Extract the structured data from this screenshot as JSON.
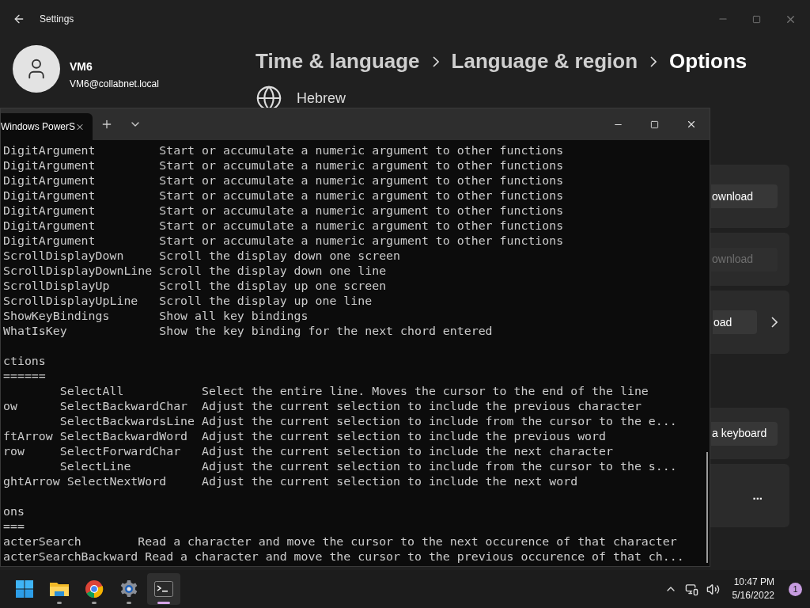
{
  "settings": {
    "title": "Settings",
    "user": {
      "name": "VM6",
      "email": "VM6@collabnet.local"
    },
    "breadcrumb": [
      {
        "label": "Time & language",
        "current": false
      },
      {
        "label": "Language & region",
        "current": false
      },
      {
        "label": "Options",
        "current": true
      }
    ],
    "language": "Hebrew",
    "cards": [
      {
        "kind": "button",
        "label": "ownload",
        "disabled": false,
        "chevron": false
      },
      {
        "kind": "button",
        "label": "ownload",
        "disabled": true,
        "chevron": false
      },
      {
        "kind": "button",
        "label": "oad",
        "disabled": false,
        "chevron": true
      },
      {
        "kind": "gap"
      },
      {
        "kind": "button",
        "label": "a keyboard",
        "disabled": false,
        "chevron": false
      },
      {
        "kind": "more",
        "label": "..."
      }
    ]
  },
  "terminal": {
    "tab_title": "Windows PowerS",
    "blocks": [
      [
        "DigitArgument         Start or accumulate a numeric argument to other functions",
        "DigitArgument         Start or accumulate a numeric argument to other functions",
        "DigitArgument         Start or accumulate a numeric argument to other functions",
        "DigitArgument         Start or accumulate a numeric argument to other functions",
        "DigitArgument         Start or accumulate a numeric argument to other functions",
        "DigitArgument         Start or accumulate a numeric argument to other functions",
        "DigitArgument         Start or accumulate a numeric argument to other functions",
        "ScrollDisplayDown     Scroll the display down one screen",
        "ScrollDisplayDownLine Scroll the display down one line",
        "ScrollDisplayUp       Scroll the display up one screen",
        "ScrollDisplayUpLine   Scroll the display up one line",
        "ShowKeyBindings       Show all key bindings",
        "WhatIsKey             Show the key binding for the next chord entered"
      ],
      [
        "ctions",
        "======",
        "        SelectAll           Select the entire line. Moves the cursor to the end of the line",
        "ow      SelectBackwardChar  Adjust the current selection to include the previous character",
        "        SelectBackwardsLine Adjust the current selection to include from the cursor to the e...",
        "ftArrow SelectBackwardWord  Adjust the current selection to include the previous word",
        "row     SelectForwardChar   Adjust the current selection to include the next character",
        "        SelectLine          Adjust the current selection to include from the cursor to the s...",
        "ghtArrow SelectNextWord     Adjust the current selection to include the next word"
      ],
      [
        "ons",
        "===",
        "acterSearch        Read a character and move the cursor to the next occurence of that character",
        "acterSearchBackward Read a character and move the cursor to the previous occurence of that ch..."
      ]
    ]
  },
  "taskbar": {
    "apps": [
      {
        "kind": "start",
        "running": false,
        "active": false
      },
      {
        "kind": "folder",
        "running": true,
        "active": false
      },
      {
        "kind": "browser",
        "running": true,
        "active": false
      },
      {
        "kind": "settings",
        "running": true,
        "active": false
      },
      {
        "kind": "terminal",
        "running": true,
        "active": true
      }
    ],
    "time": "10:47 PM",
    "date": "5/16/2022",
    "notifications": "1"
  }
}
